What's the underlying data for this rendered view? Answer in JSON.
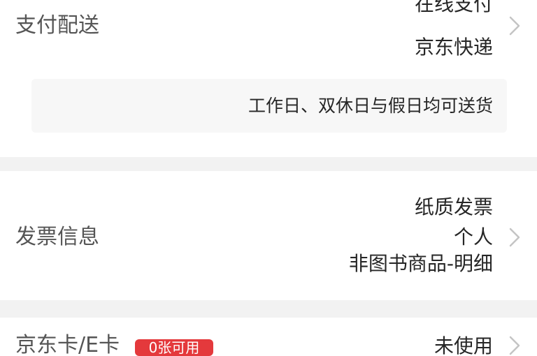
{
  "payment_section": {
    "label": "支付配送",
    "values": [
      "在线支付",
      "京东快递"
    ],
    "delivery_note": "工作日、双休日与假日均可送货"
  },
  "invoice_section": {
    "label": "发票信息",
    "values": [
      "纸质发票",
      "个人",
      "非图书商品-明细"
    ]
  },
  "card_section": {
    "label": "京东卡/E卡",
    "badge": "0张可用",
    "value": "未使用"
  },
  "icons": {
    "row_arrow": "chevron-right-icon"
  },
  "colors": {
    "badge_bg": "#e4393c",
    "divider_bg": "#f2f2f2",
    "note_bg": "#f7f7f7",
    "label_color": "#555555",
    "value_color": "#262626",
    "chevron_color": "#c4c4c4"
  }
}
